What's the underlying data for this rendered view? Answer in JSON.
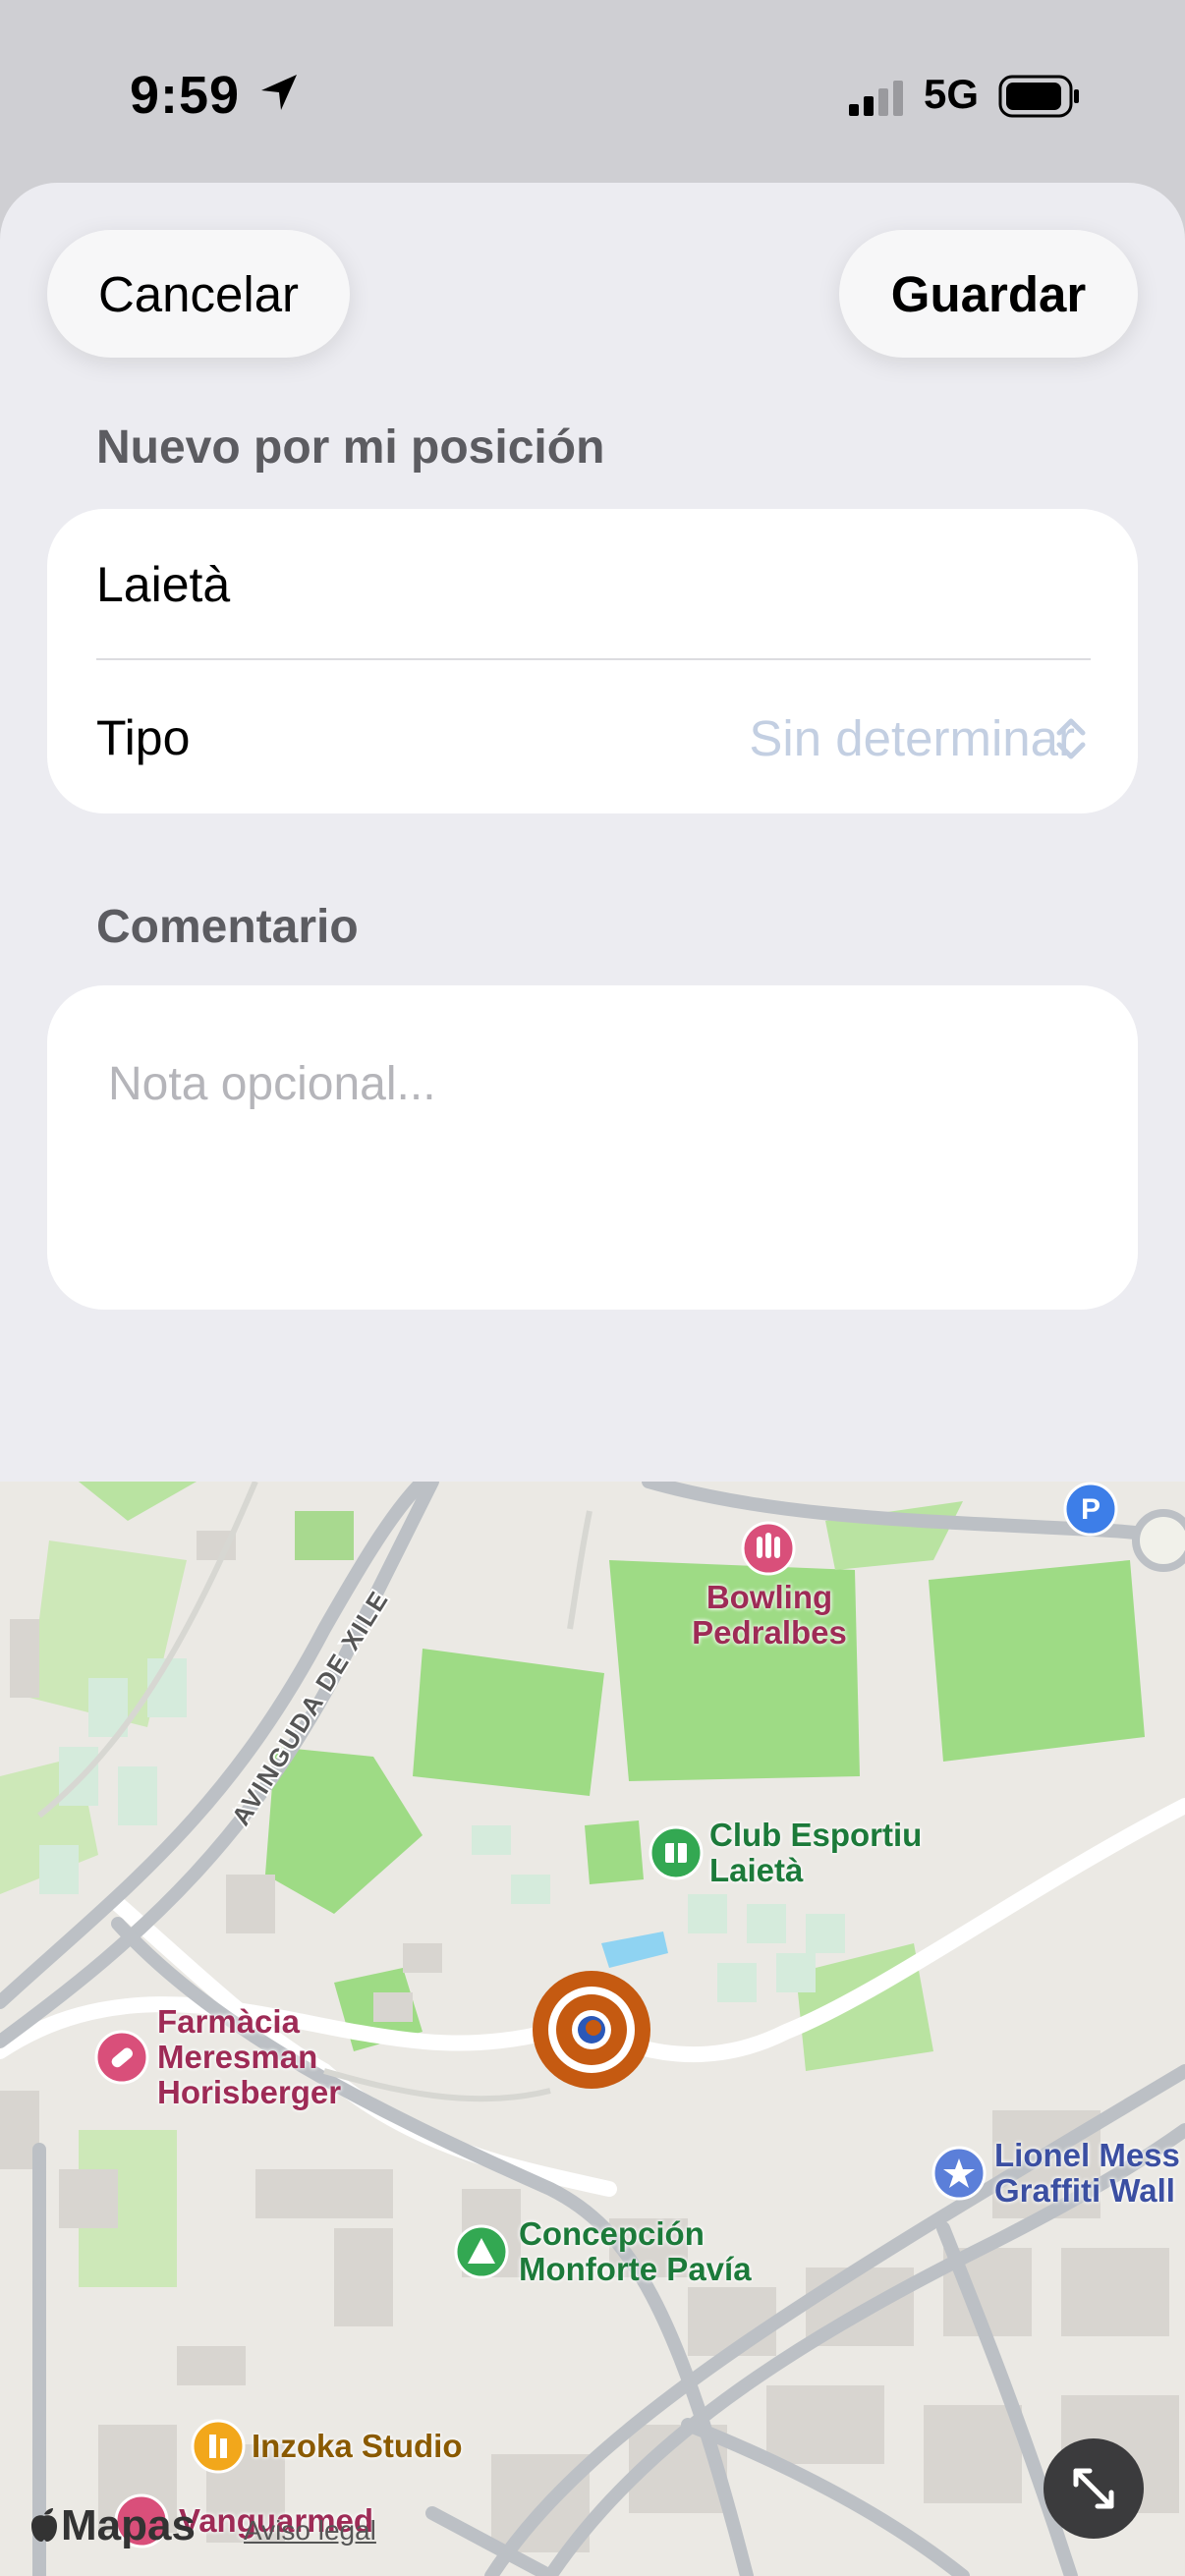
{
  "status_bar": {
    "time": "9:59",
    "network": "5G"
  },
  "header": {
    "cancel_label": "Cancelar",
    "save_label": "Guardar"
  },
  "form": {
    "section_title": "Nuevo por mi posición",
    "name_value": "Laietà",
    "type_label": "Tipo",
    "type_value": "Sin determinar",
    "comment_title": "Comentario",
    "comment_placeholder": "Nota opcional..."
  },
  "map": {
    "street_label": "AVINGUDA DE XILE",
    "pois": [
      {
        "name_line1": "Bowling",
        "name_line2": "Pedralbes"
      },
      {
        "name_line1": "Club Esportiu",
        "name_line2": "Laietà"
      },
      {
        "name_line1": "Farmàcia",
        "name_line2": "Meresman",
        "name_line3": "Horisberger"
      },
      {
        "name_line1": "Lionel Mess",
        "name_line2": "Graffiti Wall"
      },
      {
        "name_line1": "Concepción",
        "name_line2": "Monforte Pavía"
      },
      {
        "name_line1": "Inzoka Studio"
      },
      {
        "name_line1": "Vanguarmed"
      }
    ],
    "attribution": "Mapas",
    "legal": "Aviso legal"
  },
  "colors": {
    "accent_location": "#c55a11",
    "park_green": "#b9e3a1",
    "poi_pink": "#d94f7a",
    "poi_green": "#33a852",
    "poi_blue": "#5b7fd9",
    "poi_orange": "#f2a71b"
  },
  "icons": [
    "location-arrow-icon",
    "signal-icon",
    "battery-icon",
    "chevron-updown-icon",
    "bowling-icon",
    "sports-club-icon",
    "pharmacy-icon",
    "star-icon",
    "campground-icon",
    "studio-icon",
    "parking-icon",
    "expand-icon",
    "apple-logo-icon"
  ]
}
